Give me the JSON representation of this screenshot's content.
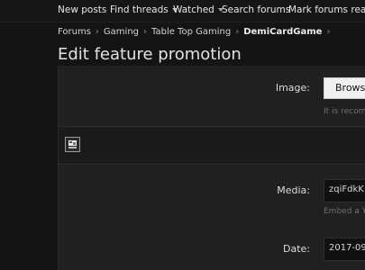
{
  "nav": {
    "new_posts": "New posts",
    "find_threads": "Find threads",
    "watched": "Watched",
    "search_forums": "Search forums",
    "mark_read": "Mark forums read"
  },
  "breadcrumb": [
    "Forums",
    "Gaming",
    "Table Top Gaming",
    "DemiCardGame"
  ],
  "page_title": "Edit feature promotion",
  "form": {
    "image_label": "Image:",
    "browse_label": "Browse",
    "image_hint": "It is recom",
    "media_label": "Media:",
    "media_value": "zqiFdkK",
    "media_hint": "Embed a Y",
    "date_label": "Date:",
    "date_value": "2017-09"
  }
}
